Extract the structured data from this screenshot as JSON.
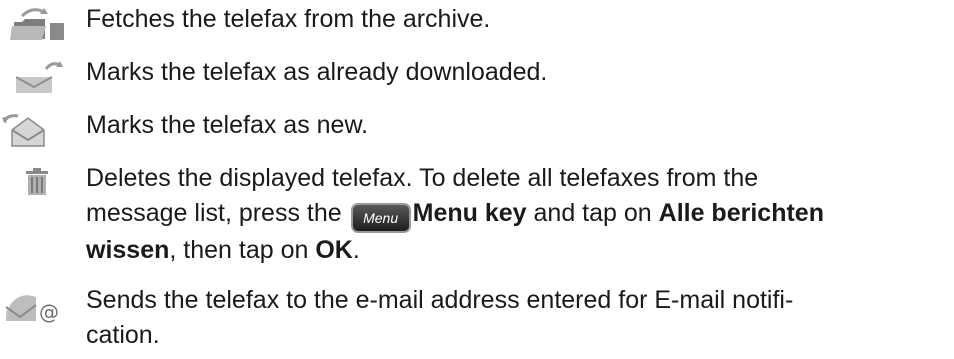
{
  "items": [
    {
      "icon": "folder-fetch-icon",
      "text": "Fetches the telefax from the archive."
    },
    {
      "icon": "envelope-downloaded-icon",
      "text": "Marks the telefax as already downloaded."
    },
    {
      "icon": "open-envelope-new-icon",
      "text": "Marks the telefax as new."
    },
    {
      "icon": "trash-icon",
      "line1": "Deletes the displayed telefax. To delete all telefaxes from the",
      "line2_pre": "message list, press the",
      "menu_key_label": "Menu",
      "menu_key_name": "Menu key",
      "line2_mid": "and tap on",
      "option": "Alle berichten",
      "option_cont": "wissen",
      "line3_mid": ", then tap on",
      "ok": "OK",
      "line3_end": "."
    },
    {
      "icon": "email-send-icon",
      "line1": "Sends the telefax to the e-mail address entered for E-mail notifi-",
      "line2": "cation."
    }
  ]
}
